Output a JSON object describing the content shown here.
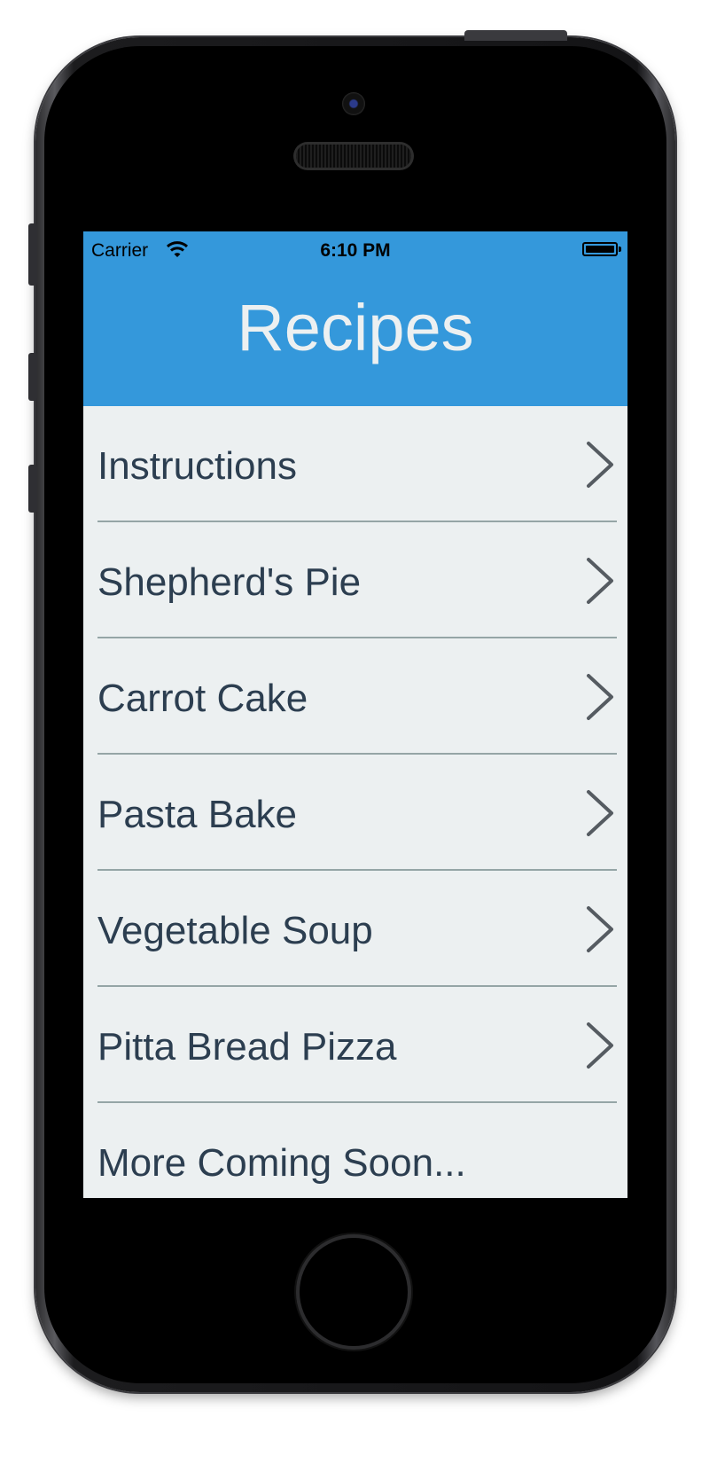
{
  "status_bar": {
    "carrier": "Carrier",
    "time": "6:10 PM",
    "battery_level": 1.0,
    "wifi_icon": "wifi-icon"
  },
  "header": {
    "title": "Recipes",
    "background_color": "#3498db",
    "title_color": "#ecf0f1"
  },
  "list": {
    "background_color": "#ecf0f1",
    "text_color": "#2c3e50",
    "chevron_icon": "chevron-right-icon",
    "items": [
      {
        "label": "Instructions"
      },
      {
        "label": "Shepherd's Pie"
      },
      {
        "label": "Carrot Cake"
      },
      {
        "label": "Pasta Bake"
      },
      {
        "label": "Vegetable Soup"
      },
      {
        "label": "Pitta Bread Pizza"
      },
      {
        "label": "More Coming Soon..."
      }
    ]
  }
}
